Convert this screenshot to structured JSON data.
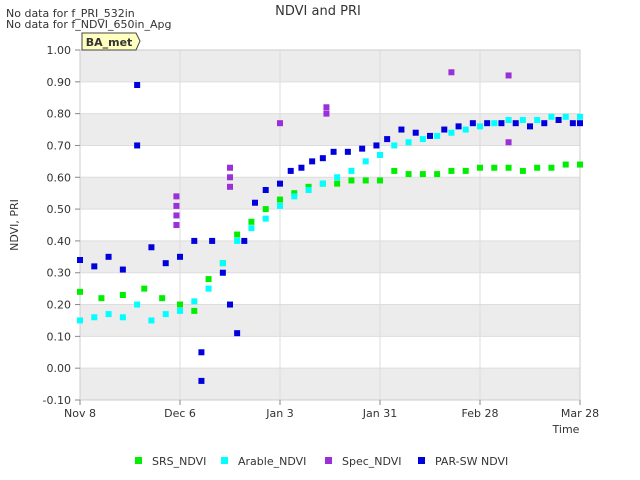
{
  "notes": [
    "No data for f_PRI_532in",
    "No data for f_NDVI_650in_Apg"
  ],
  "badge": "BA_met",
  "colors": {
    "SRS_NDVI": "#00ee00",
    "Arable_NDVI": "#00ffff",
    "Spec_NDVI": "#9b30d9",
    "PAR-SW NDVI": "#0000dd",
    "band": "#ececec",
    "badge_bg": "#ffffc0",
    "badge_text": "#aa0000"
  },
  "chart_data": {
    "type": "scatter",
    "title": "NDVI and PRI",
    "xlabel": "Time",
    "ylabel": "NDVI, PRI",
    "x_ticks": [
      "Nov 8",
      "Dec 6",
      "Jan 3",
      "Jan 31",
      "Feb 28",
      "Mar 28"
    ],
    "xlim": [
      "Nov 8",
      "Mar 28"
    ],
    "ylim": [
      -0.1,
      1.0
    ],
    "y_ticks": [
      "-0.10",
      "0.00",
      "0.10",
      "0.20",
      "0.30",
      "0.40",
      "0.50",
      "0.60",
      "0.70",
      "0.80",
      "0.90",
      "1.00"
    ],
    "legend_position": "bottom",
    "series": [
      {
        "name": "SRS_NDVI",
        "points": [
          [
            "Nov 8",
            0.24
          ],
          [
            "Nov 14",
            0.22
          ],
          [
            "Nov 20",
            0.23
          ],
          [
            "Nov 26",
            0.25
          ],
          [
            "Dec 1",
            0.22
          ],
          [
            "Dec 6",
            0.2
          ],
          [
            "Dec 10",
            0.18
          ],
          [
            "Dec 14",
            0.28
          ],
          [
            "Dec 18",
            0.33
          ],
          [
            "Dec 22",
            0.42
          ],
          [
            "Dec 26",
            0.46
          ],
          [
            "Dec 30",
            0.5
          ],
          [
            "Jan 3",
            0.53
          ],
          [
            "Jan 7",
            0.55
          ],
          [
            "Jan 11",
            0.57
          ],
          [
            "Jan 15",
            0.58
          ],
          [
            "Jan 19",
            0.58
          ],
          [
            "Jan 23",
            0.59
          ],
          [
            "Jan 27",
            0.59
          ],
          [
            "Jan 31",
            0.59
          ],
          [
            "Feb 4",
            0.62
          ],
          [
            "Feb 8",
            0.61
          ],
          [
            "Feb 12",
            0.61
          ],
          [
            "Feb 16",
            0.61
          ],
          [
            "Feb 20",
            0.62
          ],
          [
            "Feb 24",
            0.62
          ],
          [
            "Feb 28",
            0.63
          ],
          [
            "Mar 4",
            0.63
          ],
          [
            "Mar 8",
            0.63
          ],
          [
            "Mar 12",
            0.62
          ],
          [
            "Mar 16",
            0.63
          ],
          [
            "Mar 20",
            0.63
          ],
          [
            "Mar 24",
            0.64
          ],
          [
            "Mar 28",
            0.64
          ]
        ]
      },
      {
        "name": "Arable_NDVI",
        "points": [
          [
            "Nov 8",
            0.15
          ],
          [
            "Nov 12",
            0.16
          ],
          [
            "Nov 16",
            0.17
          ],
          [
            "Nov 20",
            0.16
          ],
          [
            "Nov 24",
            0.2
          ],
          [
            "Nov 28",
            0.15
          ],
          [
            "Dec 2",
            0.17
          ],
          [
            "Dec 6",
            0.18
          ],
          [
            "Dec 10",
            0.21
          ],
          [
            "Dec 14",
            0.25
          ],
          [
            "Dec 18",
            0.33
          ],
          [
            "Dec 22",
            0.4
          ],
          [
            "Dec 26",
            0.44
          ],
          [
            "Dec 30",
            0.47
          ],
          [
            "Jan 3",
            0.51
          ],
          [
            "Jan 7",
            0.54
          ],
          [
            "Jan 11",
            0.56
          ],
          [
            "Jan 15",
            0.58
          ],
          [
            "Jan 19",
            0.6
          ],
          [
            "Jan 23",
            0.62
          ],
          [
            "Jan 27",
            0.65
          ],
          [
            "Jan 31",
            0.67
          ],
          [
            "Feb 4",
            0.7
          ],
          [
            "Feb 8",
            0.71
          ],
          [
            "Feb 12",
            0.72
          ],
          [
            "Feb 16",
            0.73
          ],
          [
            "Feb 20",
            0.74
          ],
          [
            "Feb 24",
            0.75
          ],
          [
            "Feb 28",
            0.76
          ],
          [
            "Mar 4",
            0.77
          ],
          [
            "Mar 8",
            0.78
          ],
          [
            "Mar 12",
            0.78
          ],
          [
            "Mar 16",
            0.78
          ],
          [
            "Mar 20",
            0.79
          ],
          [
            "Mar 24",
            0.79
          ],
          [
            "Mar 28",
            0.79
          ]
        ]
      },
      {
        "name": "Spec_NDVI",
        "points": [
          [
            "Dec 5",
            0.45
          ],
          [
            "Dec 5",
            0.48
          ],
          [
            "Dec 5",
            0.51
          ],
          [
            "Dec 5",
            0.54
          ],
          [
            "Dec 20",
            0.57
          ],
          [
            "Dec 20",
            0.6
          ],
          [
            "Dec 20",
            0.63
          ],
          [
            "Jan 3",
            0.77
          ],
          [
            "Jan 16",
            0.8
          ],
          [
            "Jan 16",
            0.82
          ],
          [
            "Feb 20",
            0.93
          ],
          [
            "Mar 8",
            0.92
          ],
          [
            "Mar 8",
            0.71
          ]
        ]
      },
      {
        "name": "PAR-SW NDVI",
        "points": [
          [
            "Nov 8",
            0.34
          ],
          [
            "Nov 12",
            0.32
          ],
          [
            "Nov 16",
            0.35
          ],
          [
            "Nov 20",
            0.31
          ],
          [
            "Nov 24",
            0.89
          ],
          [
            "Nov 24",
            0.7
          ],
          [
            "Nov 28",
            0.38
          ],
          [
            "Dec 2",
            0.33
          ],
          [
            "Dec 6",
            0.35
          ],
          [
            "Dec 10",
            0.4
          ],
          [
            "Dec 12",
            0.05
          ],
          [
            "Dec 12",
            -0.04
          ],
          [
            "Dec 15",
            0.4
          ],
          [
            "Dec 18",
            0.3
          ],
          [
            "Dec 20",
            0.2
          ],
          [
            "Dec 22",
            0.11
          ],
          [
            "Dec 24",
            0.4
          ],
          [
            "Dec 27",
            0.52
          ],
          [
            "Dec 30",
            0.56
          ],
          [
            "Jan 3",
            0.58
          ],
          [
            "Jan 6",
            0.62
          ],
          [
            "Jan 9",
            0.63
          ],
          [
            "Jan 12",
            0.65
          ],
          [
            "Jan 15",
            0.66
          ],
          [
            "Jan 18",
            0.68
          ],
          [
            "Jan 22",
            0.68
          ],
          [
            "Jan 26",
            0.69
          ],
          [
            "Jan 30",
            0.7
          ],
          [
            "Feb 2",
            0.72
          ],
          [
            "Feb 6",
            0.75
          ],
          [
            "Feb 10",
            0.74
          ],
          [
            "Feb 14",
            0.73
          ],
          [
            "Feb 18",
            0.75
          ],
          [
            "Feb 22",
            0.76
          ],
          [
            "Feb 26",
            0.77
          ],
          [
            "Mar 2",
            0.77
          ],
          [
            "Mar 6",
            0.77
          ],
          [
            "Mar 10",
            0.77
          ],
          [
            "Mar 14",
            0.76
          ],
          [
            "Mar 18",
            0.77
          ],
          [
            "Mar 22",
            0.78
          ],
          [
            "Mar 26",
            0.77
          ],
          [
            "Mar 28",
            0.77
          ]
        ]
      }
    ]
  }
}
